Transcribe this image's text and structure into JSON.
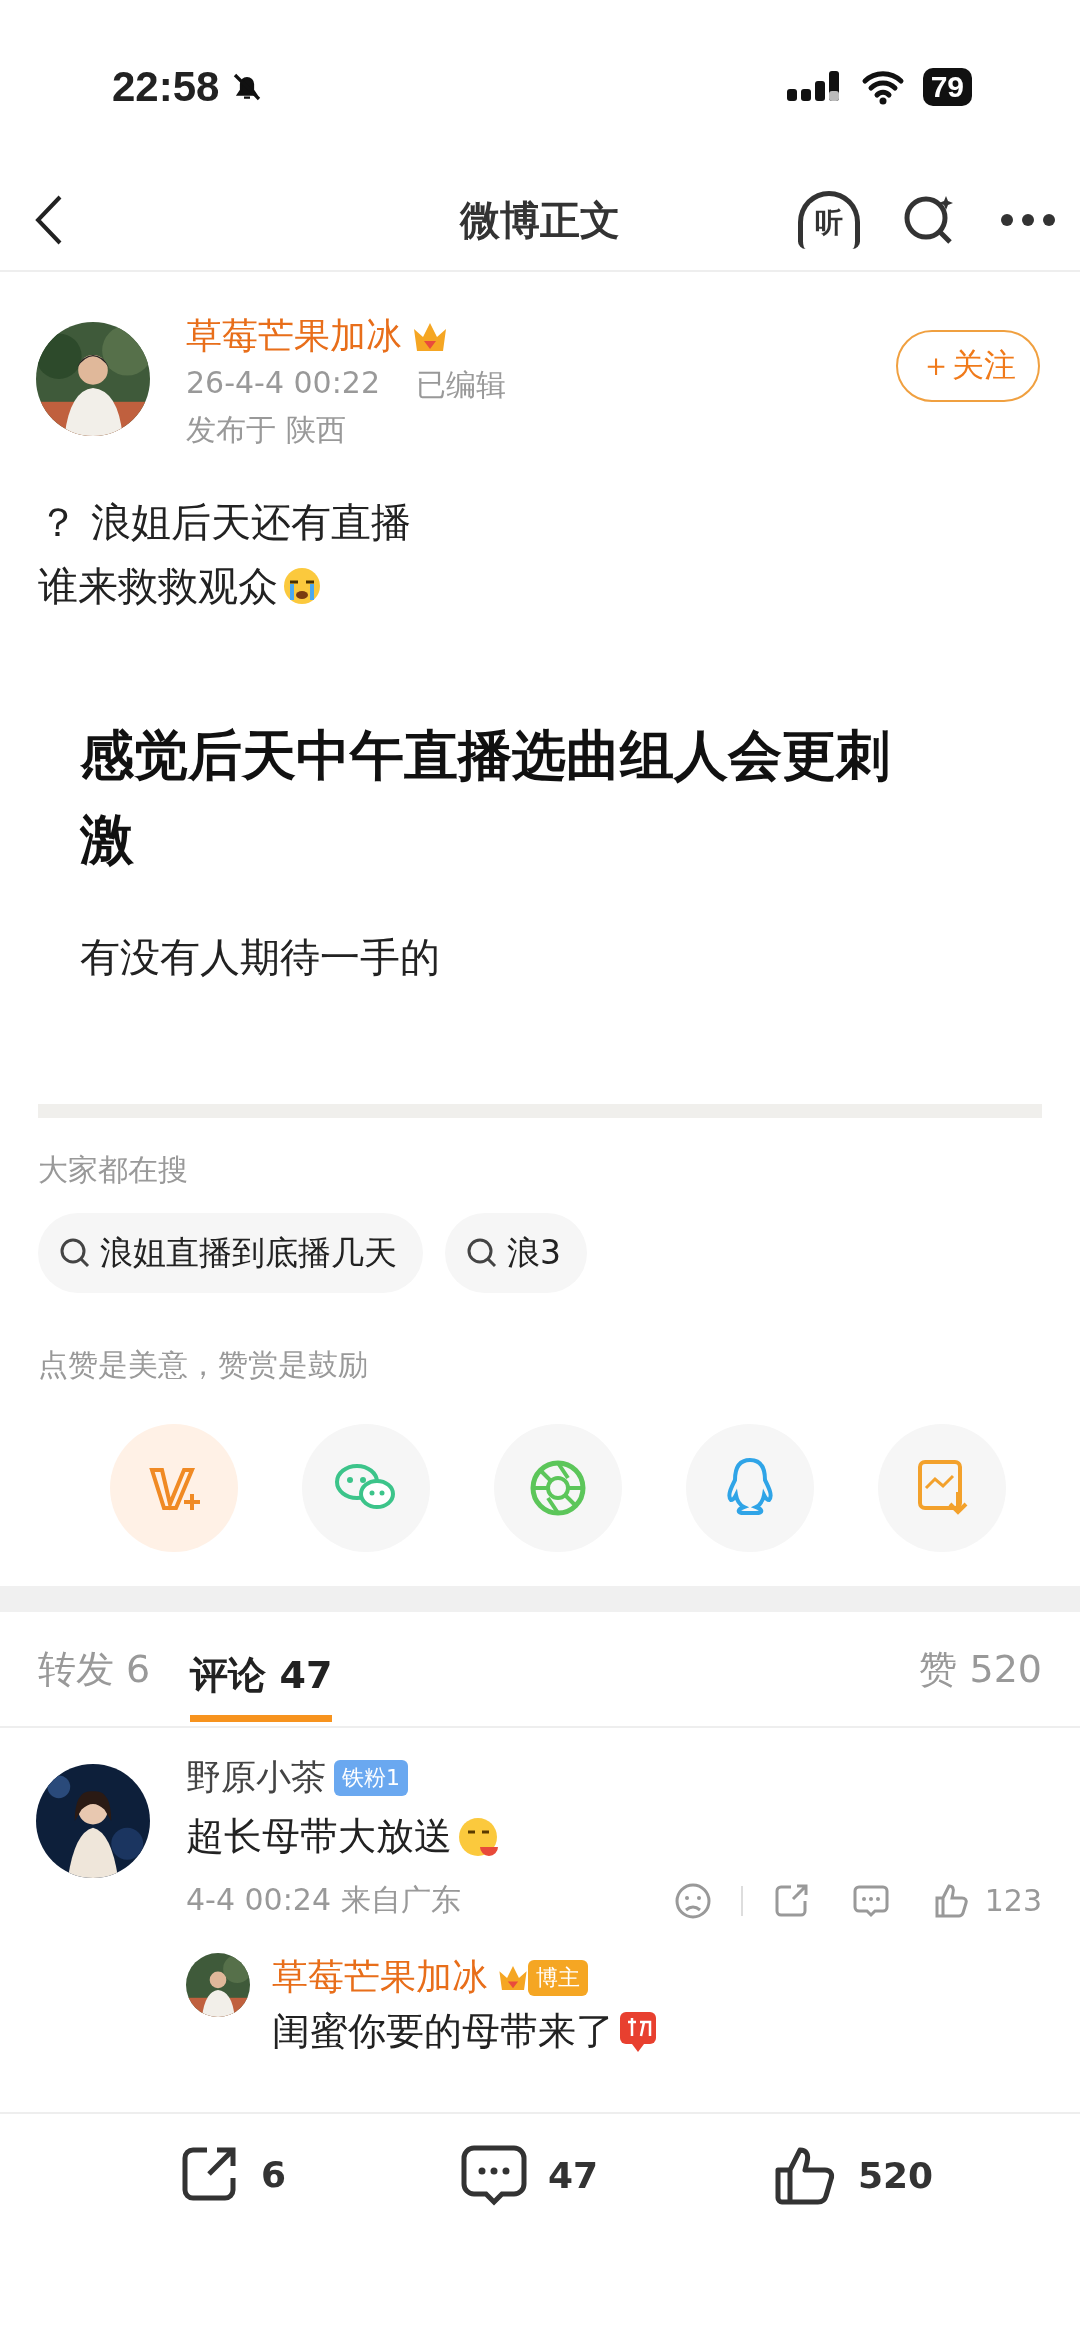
{
  "status_bar": {
    "time": "22:58",
    "battery": "79"
  },
  "nav": {
    "title": "微博正文",
    "listen_label": "听"
  },
  "post": {
    "author": "草莓芒果加冰",
    "timestamp": "26-4-4 00:22",
    "edited": "已编辑",
    "location": "发布于 陕西",
    "follow_label": "＋关注",
    "lines": [
      "？ 浪姐后天还有直播",
      "谁来救救观众"
    ],
    "image": {
      "headline": "感觉后天中午直播选曲组人会更刺激",
      "subline": "有没有人期待一手的"
    }
  },
  "trending": {
    "title": "大家都在搜",
    "chips": [
      "浪姐直播到底播几天",
      "浪3"
    ]
  },
  "reward": {
    "caption": "点赞是美意，赞赏是鼓励"
  },
  "share_targets": [
    {
      "kind": "vplus"
    },
    {
      "kind": "wechat"
    },
    {
      "kind": "moments"
    },
    {
      "kind": "qq"
    },
    {
      "kind": "save"
    }
  ],
  "tabs": [
    {
      "label": "转发 6",
      "selected": false
    },
    {
      "label": "评论 47",
      "selected": true
    }
  ],
  "likes_tab": "赞 520",
  "comments": [
    {
      "author": "野原小茶",
      "badge": "铁粉1",
      "text": "超长母带大放送",
      "meta": "4-4 00:24 来自广东",
      "likes": "123",
      "reply": {
        "author": "草莓芒果加冰",
        "badge": "博主",
        "text": "闺蜜你要的母带来了"
      }
    }
  ],
  "bottom_bar": {
    "reposts": "6",
    "comments": "47",
    "likes": "520"
  }
}
